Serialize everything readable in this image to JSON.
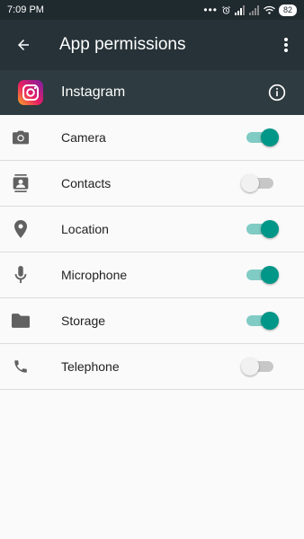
{
  "status_bar": {
    "time": "7:09 PM",
    "battery": "82",
    "icons": [
      "more-dots-icon",
      "alarm-icon",
      "signal-icon",
      "signal-icon",
      "wifi-icon",
      "battery-icon"
    ]
  },
  "toolbar": {
    "title": "App permissions",
    "back_icon": "arrow-back-icon",
    "more_icon": "more-vert-icon"
  },
  "app": {
    "name": "Instagram",
    "icon": "instagram-icon",
    "info_icon": "info-icon"
  },
  "permissions": [
    {
      "label": "Camera",
      "icon": "camera-icon",
      "enabled": true
    },
    {
      "label": "Contacts",
      "icon": "contacts-icon",
      "enabled": false
    },
    {
      "label": "Location",
      "icon": "location-icon",
      "enabled": true
    },
    {
      "label": "Microphone",
      "icon": "microphone-icon",
      "enabled": true
    },
    {
      "label": "Storage",
      "icon": "folder-icon",
      "enabled": true
    },
    {
      "label": "Telephone",
      "icon": "phone-icon",
      "enabled": false
    }
  ],
  "colors": {
    "toolbar": "#263238",
    "app_header": "#2e3b40",
    "accent": "#009688"
  }
}
